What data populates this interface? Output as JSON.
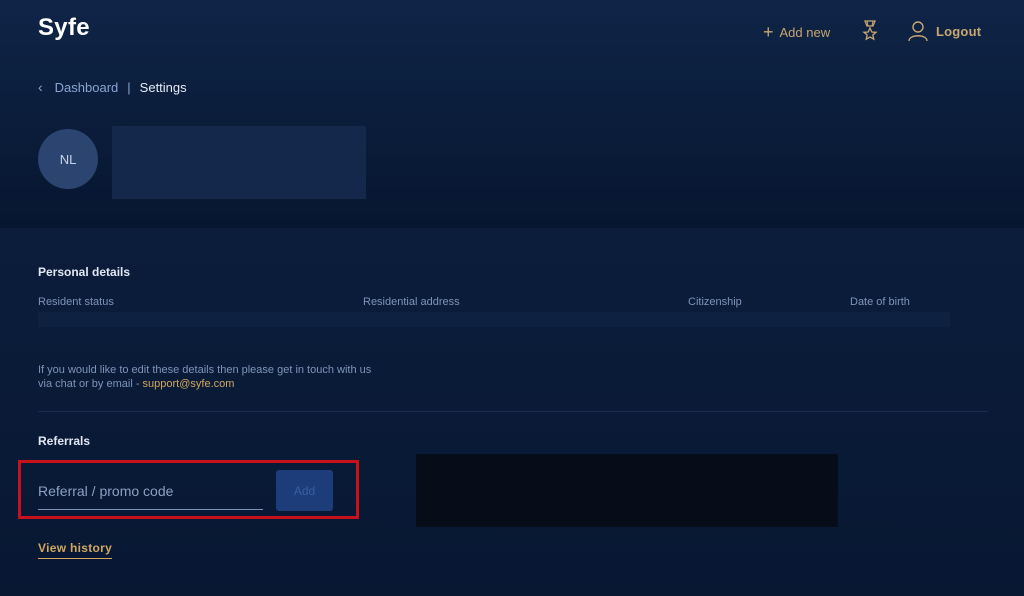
{
  "header": {
    "logo": "Syfe",
    "add_new_label": "Add new",
    "logout_label": "Logout"
  },
  "breadcrumb": {
    "parent": "Dashboard",
    "separator": "|",
    "current": "Settings"
  },
  "profile": {
    "initials": "NL"
  },
  "personal_details": {
    "title": "Personal details",
    "columns": [
      "Resident status",
      "Residential address",
      "Citizenship",
      "Date of birth"
    ],
    "note_line1": "If you would like to edit these details then please get in touch with us",
    "note_line2_prefix": "via chat or by email - ",
    "support_email": "support@syfe.com"
  },
  "referrals": {
    "title": "Referrals",
    "input_placeholder": "Referral / promo code",
    "input_value": "",
    "add_button_label": "Add",
    "view_history_label": "View history"
  },
  "colors": {
    "background": "#0a1a33",
    "accent_gold": "#c8a670",
    "highlight_red": "#c8111b",
    "button_blue": "#1c3d7a"
  },
  "icons": {
    "add": "plus-icon",
    "badge": "ribbon-badge-icon",
    "user": "user-icon",
    "back": "chevron-left-icon"
  }
}
